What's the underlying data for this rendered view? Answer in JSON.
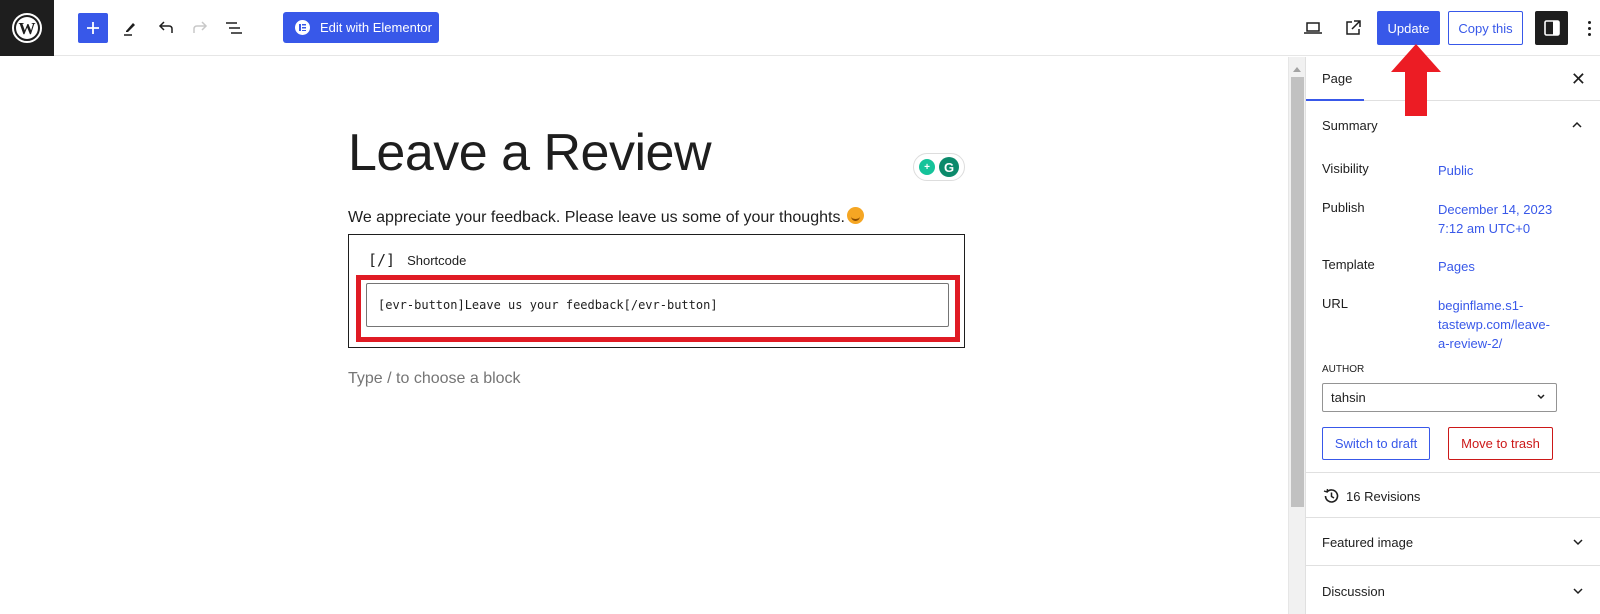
{
  "toolbar": {
    "logo": "wordpress-logo",
    "add_block": "+",
    "tools": [
      "pencil-icon",
      "undo-icon",
      "redo-icon",
      "list-view-icon"
    ],
    "elementor_label": "Edit with Elementor",
    "update_label": "Update",
    "copy_label": "Copy this"
  },
  "editor": {
    "title": "Leave a Review",
    "intro": "We appreciate your feedback. Please leave us some of your thoughts.",
    "shortcode": {
      "icon": "[/]",
      "label": "Shortcode",
      "value": "[evr-button]Leave us your feedback[/evr-button]"
    },
    "appender_placeholder": "Type / to choose a block",
    "grammarly_letter": "G"
  },
  "sidebar": {
    "tab_page": "Page",
    "close": "✕",
    "summary": {
      "title": "Summary",
      "rows": [
        {
          "key": "Visibility",
          "value": "Public"
        },
        {
          "key": "Publish",
          "value": "December 14, 2023 7:12 am UTC+0"
        },
        {
          "key": "Template",
          "value": "Pages"
        },
        {
          "key": "URL",
          "value": "beginflame.s1-tastewp.com/leave-a-review-2/"
        }
      ],
      "author_label": "AUTHOR",
      "author_value": "tahsin",
      "switch_draft": "Switch to draft",
      "move_trash": "Move to trash"
    },
    "revisions": "16 Revisions",
    "featured_image": "Featured image",
    "discussion": "Discussion"
  },
  "colors": {
    "accent": "#3858e9",
    "danger": "#cc1818",
    "highlight": "#e01b24",
    "dark": "#1e1e1e"
  }
}
